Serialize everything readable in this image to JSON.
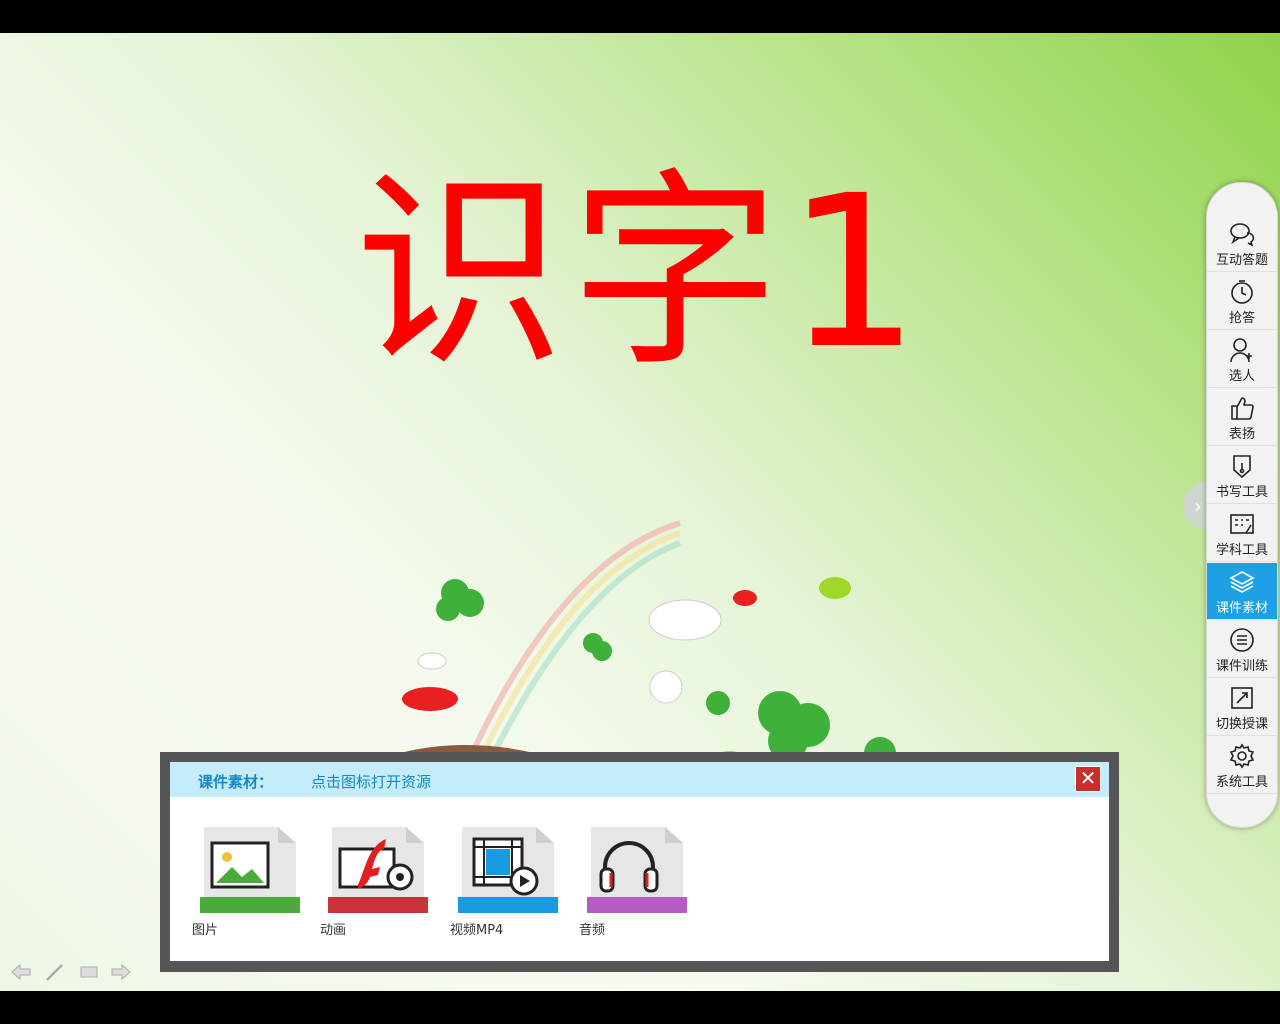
{
  "slide": {
    "title": "识字1"
  },
  "sidebar": {
    "items": [
      {
        "label": "互动答题",
        "icon": "chat-bubbles-icon"
      },
      {
        "label": "抢答",
        "icon": "stopwatch-icon"
      },
      {
        "label": "选人",
        "icon": "add-person-icon"
      },
      {
        "label": "表扬",
        "icon": "thumbs-up-icon"
      },
      {
        "label": "书写工具",
        "icon": "pen-nib-icon"
      },
      {
        "label": "学科工具",
        "icon": "toolbox-icon"
      },
      {
        "label": "课件素材",
        "icon": "layers-icon",
        "active": true
      },
      {
        "label": "课件训练",
        "icon": "list-icon"
      },
      {
        "label": "切换授课",
        "icon": "switch-icon"
      },
      {
        "label": "系统工具",
        "icon": "gear-icon"
      }
    ]
  },
  "panel": {
    "title": "课件素材：",
    "hint": "点击图标打开资源",
    "resources": [
      {
        "label": "图片",
        "icon": "image-icon",
        "color": "#4aaa3c"
      },
      {
        "label": "动画",
        "icon": "flash-icon",
        "color": "#c8333a"
      },
      {
        "label": "视频MP4",
        "icon": "video-icon",
        "color": "#1a9ae0"
      },
      {
        "label": "音频",
        "icon": "headphones-icon",
        "color": "#b45cc4"
      }
    ]
  },
  "colors": {
    "title_red": "#ff0000",
    "accent_blue": "#1ea0e6",
    "close_red": "#c9302c"
  }
}
